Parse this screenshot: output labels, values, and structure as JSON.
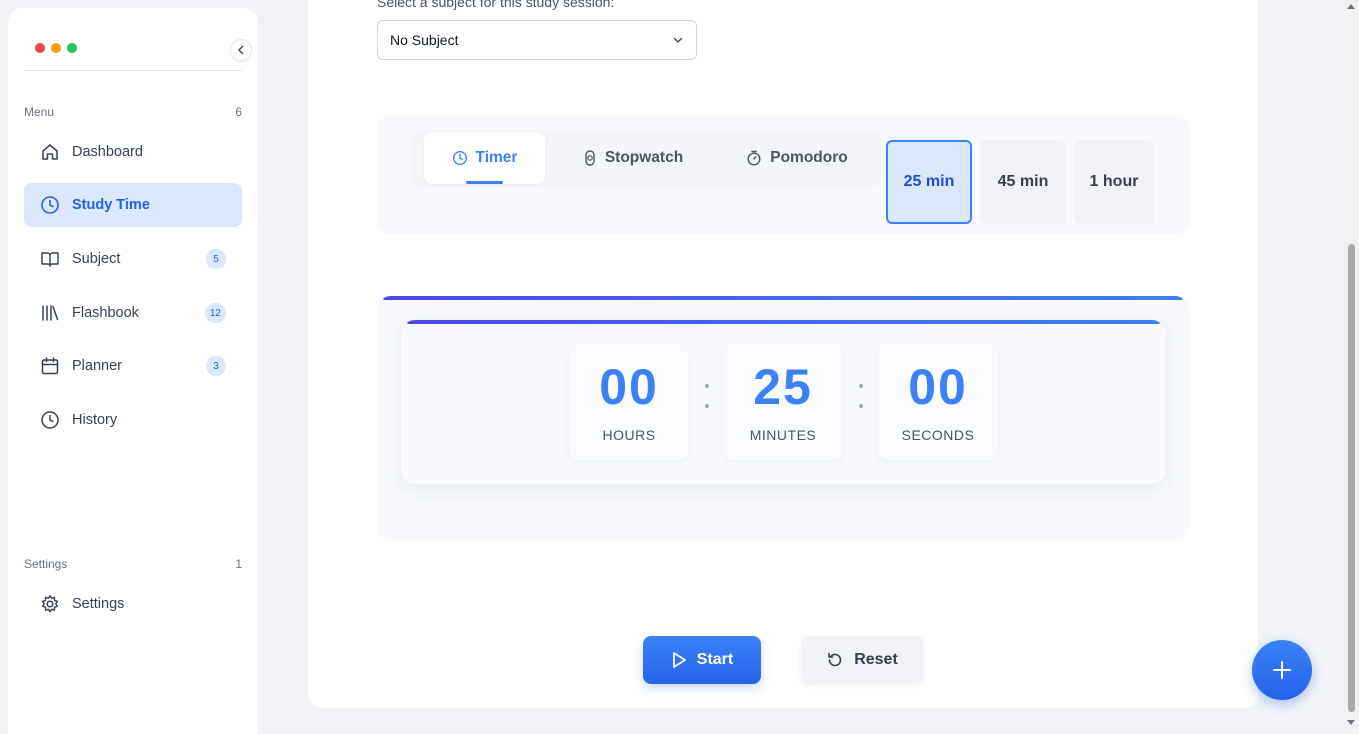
{
  "sidebar": {
    "menu_heading": "Menu",
    "menu_count": "6",
    "items": [
      {
        "label": "Dashboard",
        "icon": "home-icon",
        "badge": ""
      },
      {
        "label": "Study Time",
        "icon": "clock-icon",
        "badge": "",
        "active": true
      },
      {
        "label": "Subject",
        "icon": "book-open-icon",
        "badge": "5"
      },
      {
        "label": "Flashbook",
        "icon": "library-icon",
        "badge": "12"
      },
      {
        "label": "Planner",
        "icon": "calendar-icon",
        "badge": "3"
      },
      {
        "label": "History",
        "icon": "history-icon",
        "badge": ""
      }
    ],
    "settings_heading": "Settings",
    "settings_count": "1",
    "settings_item": {
      "label": "Settings",
      "icon": "gear-icon"
    }
  },
  "subject": {
    "label": "Select a subject for this study session:",
    "selected": "No Subject"
  },
  "modes": {
    "tabs": [
      {
        "label": "Timer",
        "icon": "clock-icon",
        "active": true
      },
      {
        "label": "Stopwatch",
        "icon": "stopwatch-icon"
      },
      {
        "label": "Pomodoro",
        "icon": "timer-icon"
      }
    ],
    "presets": [
      {
        "label": "25 min",
        "active": true
      },
      {
        "label": "45 min"
      },
      {
        "label": "1 hour"
      }
    ]
  },
  "timer": {
    "hours": "00",
    "minutes": "25",
    "seconds": "00",
    "hours_label": "HOURS",
    "minutes_label": "MINUTES",
    "seconds_label": "SECONDS"
  },
  "controls": {
    "start_label": "Start",
    "reset_label": "Reset"
  },
  "colors": {
    "accent": "#3b82f6",
    "active_bg": "#dbe7fb"
  }
}
